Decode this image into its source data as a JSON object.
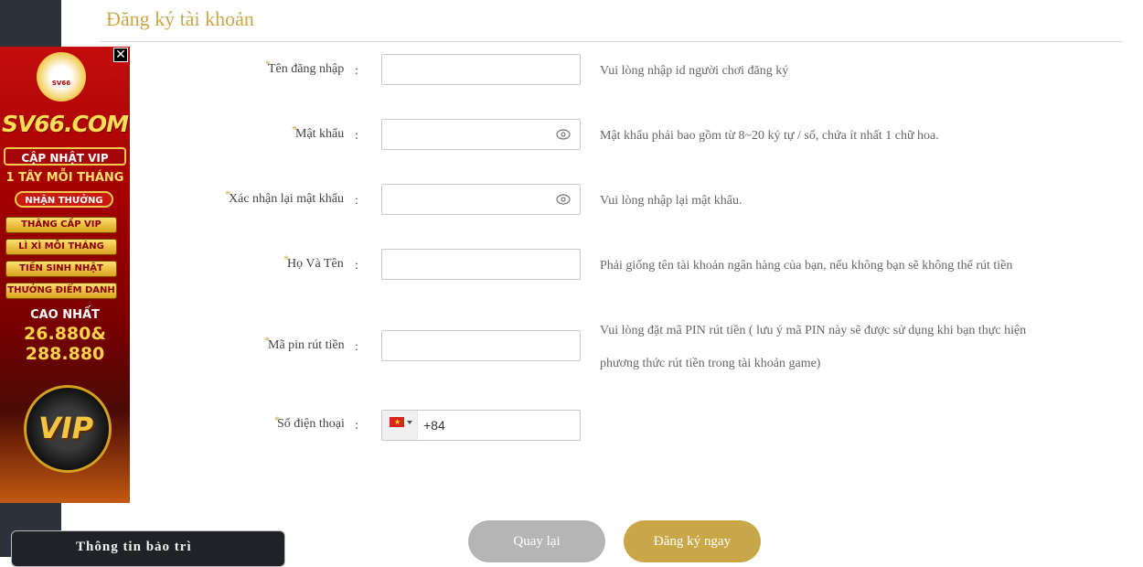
{
  "page": {
    "title": "Đăng ký tài khoản"
  },
  "form": {
    "required_mark": "*",
    "colon": ":",
    "fields": [
      {
        "label": "Tên đăng nhập",
        "value": "",
        "hint": "Vui lòng nhập id người chơi đăng ký"
      },
      {
        "label": "Mật khẩu",
        "value": "",
        "hint": "Mật khẩu phải bao gồm từ 8~20 ký tự / số, chứa ít nhất 1 chữ hoa.",
        "icon": "eye-icon"
      },
      {
        "label": "Xác nhận lại mật khẩu",
        "value": "",
        "hint": "Vui lòng nhập lại mật khẩu.",
        "icon": "eye-icon"
      },
      {
        "label": "Họ Và Tên",
        "value": "",
        "hint": "Phải giống tên tài khoản ngân hàng của bạn, nếu không bạn sẽ không thể rút tiền"
      },
      {
        "label": "Mã pin rút tiền",
        "value": "",
        "hint_line1": "Vui lòng đặt mã PIN rút tiền ( lưu ý mã PIN này sẽ được sử dụng khi bạn thực hiện",
        "hint_line2": "phương thức rút tiền trong tài khoản game)"
      },
      {
        "label": "Số điện thoại",
        "value": "+84",
        "flag": "vietnam-flag-icon",
        "flag_star": "★"
      }
    ]
  },
  "buttons": {
    "back": "Quay lại",
    "submit": "Đăng ký ngay"
  },
  "ad": {
    "close": "✕",
    "logo_text": "SV66",
    "brand": "SV66.COM",
    "vip_update": "CẬP NHẬT VIP",
    "per_month": "1 TÂY MỖI THÁNG",
    "claim": "NHẬN THƯỞNG",
    "perks": [
      "THĂNG CẤP VIP",
      "LÌ XÌ MỖI THÁNG",
      "TIỀN SINH NHẬT",
      "THƯỞNG ĐIỂM DANH"
    ],
    "max_label": "CAO NHẤT",
    "amount_line1": "26.880&",
    "amount_line2": "288.880",
    "vip_word": "VIP"
  },
  "maintenance": {
    "label": "Thông tin bảo trì"
  },
  "colors": {
    "accent": "#c9a648",
    "back_button": "#b5b5b5",
    "rail": "#2d3139"
  }
}
